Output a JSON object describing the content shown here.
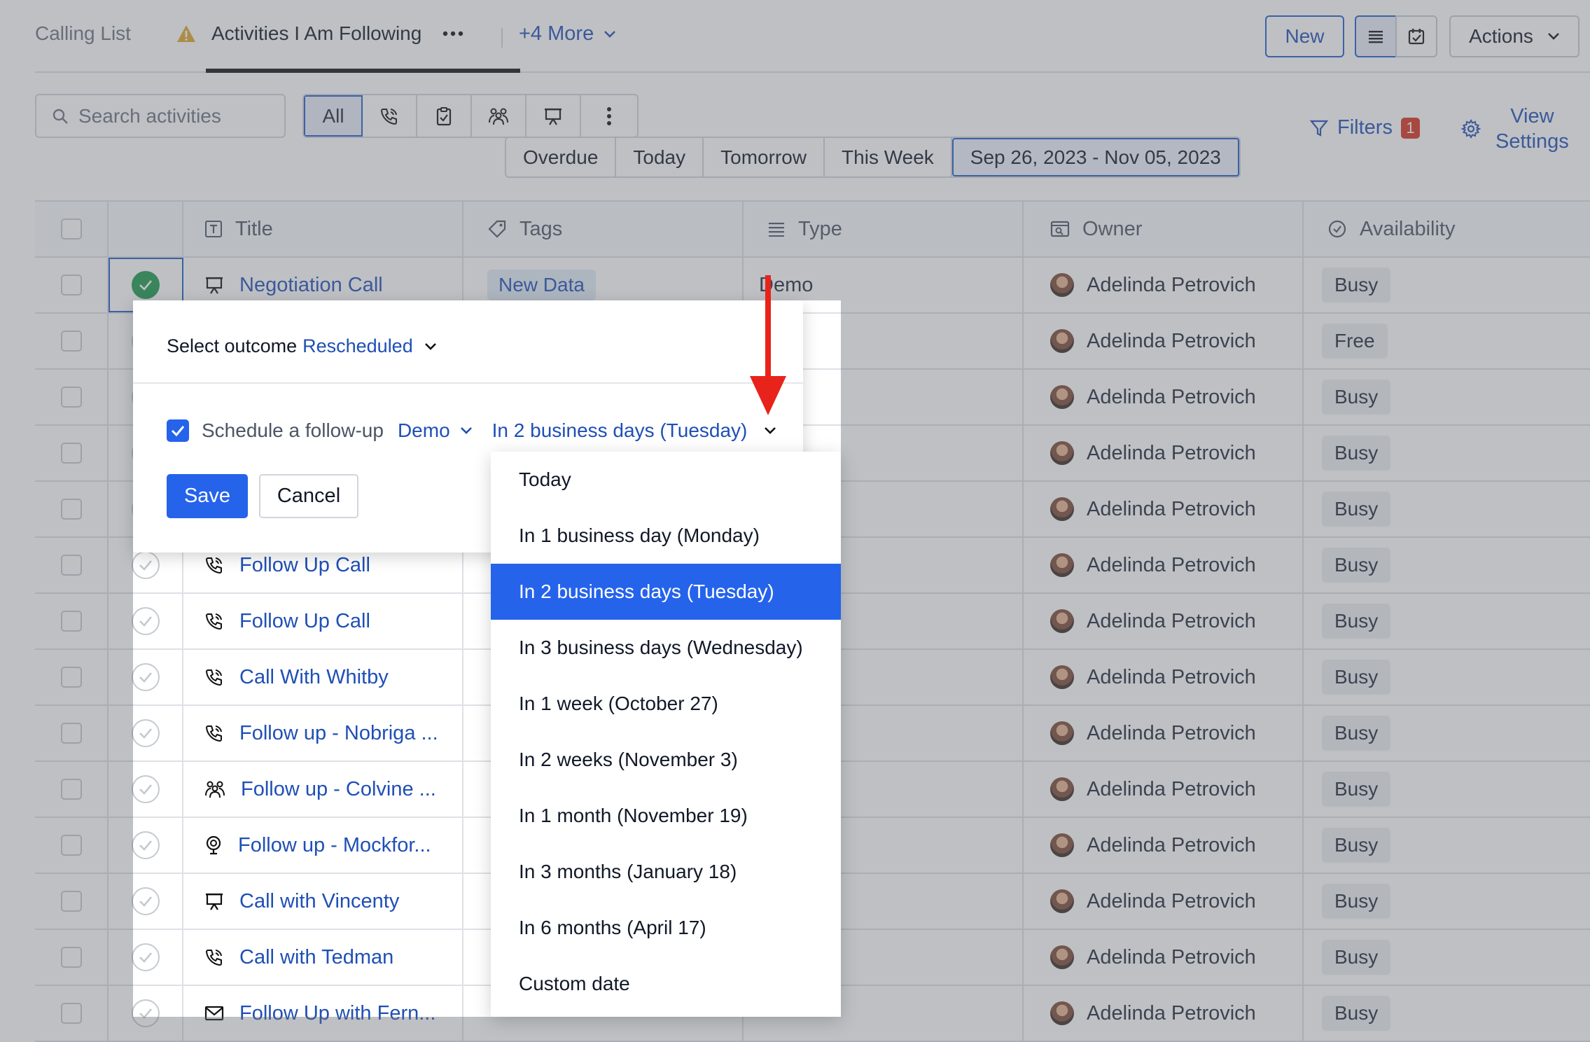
{
  "tabs": {
    "calling_list": "Calling List",
    "activities_following": "Activities I Am Following",
    "more": "+4 More"
  },
  "header_buttons": {
    "new": "New",
    "actions": "Actions"
  },
  "search": {
    "placeholder": "Search activities"
  },
  "type_filter": {
    "all": "All"
  },
  "date_filters": [
    "Overdue",
    "Today",
    "Tomorrow",
    "This Week",
    "Sep 26, 2023 - Nov 05, 2023"
  ],
  "filters": {
    "label": "Filters",
    "count": "1"
  },
  "view_settings": {
    "line1": "View",
    "line2": "Settings"
  },
  "columns": {
    "title": "Title",
    "tags": "Tags",
    "type": "Type",
    "owner": "Owner",
    "availability": "Availability"
  },
  "rows": [
    {
      "title": "Negotiation Call",
      "icon": "presentation-icon",
      "tag": "New Data",
      "type": "Demo",
      "owner": "Adelinda Petrovich",
      "availability": "Busy",
      "done": true
    },
    {
      "title": "",
      "icon": "",
      "tag": "",
      "type": "",
      "owner": "Adelinda Petrovich",
      "availability": "Free",
      "done": false
    },
    {
      "title": "",
      "icon": "",
      "tag": "",
      "type": "",
      "owner": "Adelinda Petrovich",
      "availability": "Busy",
      "done": false
    },
    {
      "title": "",
      "icon": "",
      "tag": "",
      "type": "",
      "owner": "Adelinda Petrovich",
      "availability": "Busy",
      "done": false
    },
    {
      "title": "",
      "icon": "",
      "tag": "",
      "type": "",
      "owner": "Adelinda Petrovich",
      "availability": "Busy",
      "done": false
    },
    {
      "title": "Follow Up Call",
      "icon": "phone-icon",
      "tag": "",
      "type": "",
      "owner": "Adelinda Petrovich",
      "availability": "Busy",
      "done": false
    },
    {
      "title": "Follow Up Call",
      "icon": "phone-icon",
      "tag": "",
      "type": "",
      "owner": "Adelinda Petrovich",
      "availability": "Busy",
      "done": false
    },
    {
      "title": "Call With Whitby",
      "icon": "phone-icon",
      "tag": "",
      "type": "",
      "owner": "Adelinda Petrovich",
      "availability": "Busy",
      "done": false
    },
    {
      "title": "Follow up - Nobriga ...",
      "icon": "phone-icon",
      "tag": "",
      "type": "",
      "owner": "Adelinda Petrovich",
      "availability": "Busy",
      "done": false
    },
    {
      "title": "Follow up - Colvine ...",
      "icon": "meeting-icon",
      "tag": "",
      "type": "",
      "owner": "Adelinda Petrovich",
      "availability": "Busy",
      "done": false
    },
    {
      "title": "Follow up - Mockfor...",
      "icon": "lunch-icon",
      "tag": "",
      "type": "",
      "owner": "Adelinda Petrovich",
      "availability": "Busy",
      "done": false
    },
    {
      "title": "Call with Vincenty",
      "icon": "presentation-icon",
      "tag": "",
      "type": "",
      "owner": "Adelinda Petrovich",
      "availability": "Busy",
      "done": false
    },
    {
      "title": "Call with Tedman",
      "icon": "phone-icon",
      "tag": "",
      "type": "",
      "owner": "Adelinda Petrovich",
      "availability": "Busy",
      "done": false
    },
    {
      "title": "Follow Up with Fern...",
      "icon": "mail-icon",
      "tag": "",
      "type": "",
      "owner": "Adelinda Petrovich",
      "availability": "Busy",
      "done": false
    }
  ],
  "popup": {
    "outcome_label": "Select outcome",
    "outcome_value": "Rescheduled",
    "followup_label": "Schedule a follow-up",
    "followup_type": "Demo",
    "followup_when": "In 2 business days (Tuesday)",
    "save": "Save",
    "cancel": "Cancel"
  },
  "dropdown_options": [
    "Today",
    "In 1 business day (Monday)",
    "In 2 business days (Tuesday)",
    "In 3 business days (Wednesday)",
    "In 1 week (October 27)",
    "In 2 weeks (November 3)",
    "In 1 month (November 19)",
    "In 3 months (January 18)",
    "In 6 months (April 17)",
    "Custom date"
  ],
  "dropdown_selected_index": 2,
  "colors": {
    "accent": "#2563eb",
    "link": "#1f4fb6",
    "done": "#1c9a4c",
    "badge": "#d8321e",
    "annotation_arrow": "#e8231b"
  }
}
